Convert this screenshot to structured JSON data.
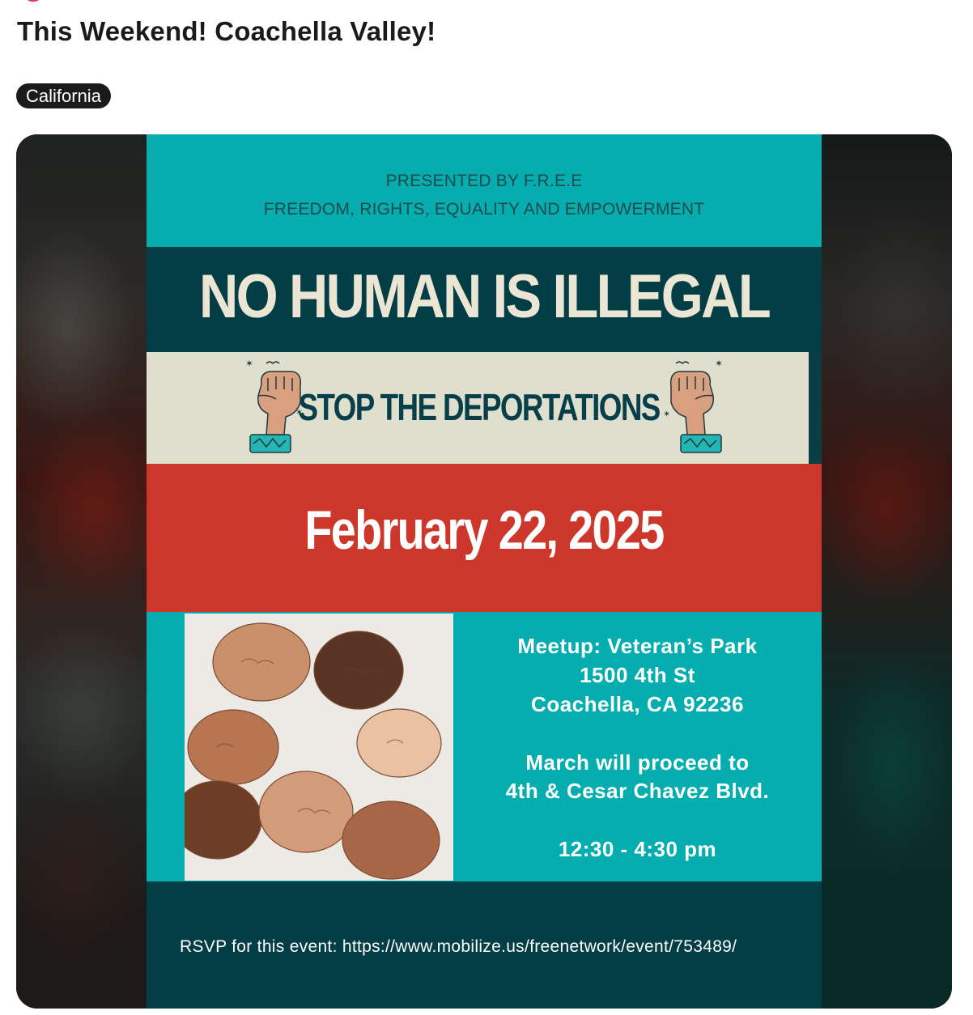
{
  "post": {
    "title": "This Weekend! Coachella Valley!",
    "tag": "California"
  },
  "colors": {
    "teal": "#06adae",
    "dark_teal": "#033d46",
    "cream": "#e0dfce",
    "red": "#cd372b",
    "tag_bg": "#1b1b1b"
  },
  "flyer": {
    "presented_by": "PRESENTED BY F.R.E.E",
    "org_name": "FREEDOM, RIGHTS, EQUALITY AND EMPOWERMENT",
    "headline": "NO HUMAN IS ILLEGAL",
    "subheadline": "STOP THE DEPORTATIONS",
    "date": "February 22, 2025",
    "meetup": "Meetup: Veteran’s Park",
    "street": "1500 4th St",
    "city": "Coachella, CA 92236",
    "march_line1": "March will proceed to",
    "march_line2": "4th & Cesar Chavez Blvd.",
    "time": "12:30 - 4:30 pm",
    "rsvp": "RSVP for this event: https://www.mobilize.us/freenetwork/event/753489/",
    "icons": [
      "raised-fist-icon",
      "raised-fist-icon"
    ],
    "photo": "hands-circle-photo"
  }
}
